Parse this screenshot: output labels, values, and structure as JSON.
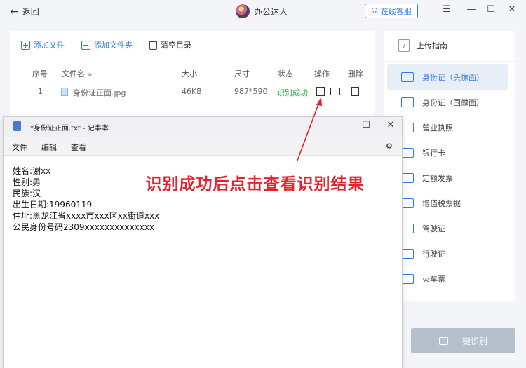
{
  "window": {
    "back_label": "返回",
    "app_title": "办公达人",
    "service_label": "在线客服"
  },
  "toolbar": {
    "add_file": "添加文件",
    "add_folder": "添加文件夹",
    "clear": "清空目录"
  },
  "table": {
    "headers": {
      "no": "序号",
      "name": "文件名",
      "size": "大小",
      "dim": "尺寸",
      "status": "状态",
      "op": "操作",
      "del": "删除"
    },
    "rows": [
      {
        "no": "1",
        "name": "身份证正面.jpg",
        "size": "46KB",
        "dim": "987*590",
        "status": "识别成功"
      }
    ]
  },
  "guide": {
    "title": "上传指南",
    "categories": [
      "身份证（头像面）",
      "身份证（国徽面）",
      "营业执照",
      "银行卡",
      "定额发票",
      "增值税票据",
      "驾驶证",
      "行驶证",
      "火车票"
    ],
    "active_index": 0,
    "one_key_label": "一键识别"
  },
  "notepad": {
    "title": "*身份证正面.txt - 记事本",
    "menu": [
      "文件",
      "编辑",
      "查看"
    ],
    "lines": [
      "姓名:谢xx",
      "性别:男",
      "民族:汉",
      "出生日期:19960119",
      "住址:黑龙江省xxxx市xxx区xx街道xxx",
      "公民身份号码2309xxxxxxxxxxxxxx"
    ]
  },
  "annotation": "识别成功后点击查看识别结果",
  "colors": {
    "accent": "#2f7be8",
    "success": "#24b24b",
    "annotation": "#e8212e"
  }
}
